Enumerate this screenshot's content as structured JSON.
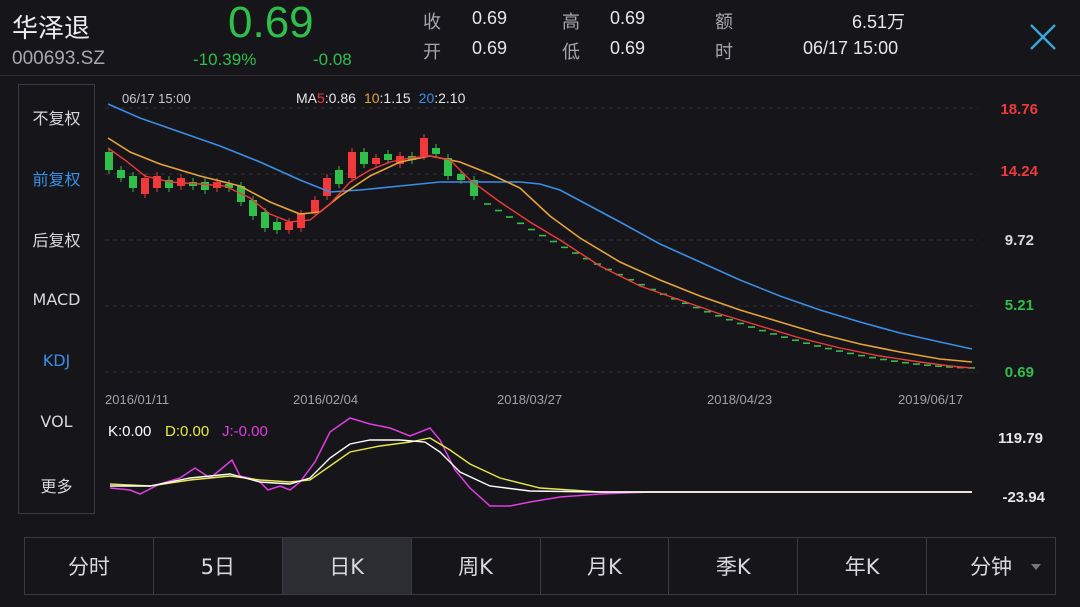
{
  "header": {
    "name": "华泽退",
    "code": "000693.SZ",
    "price": "0.69",
    "change_pct": "-10.39%",
    "change_abs": "-0.08",
    "quotes": [
      {
        "label": "收",
        "value": "0.69"
      },
      {
        "label": "高",
        "value": "0.69"
      },
      {
        "label": "额",
        "value": "6.51万"
      },
      {
        "label": "开",
        "value": "0.69"
      },
      {
        "label": "低",
        "value": "0.69"
      },
      {
        "label": "时",
        "value": "06/17 15:00"
      }
    ]
  },
  "sidebar": {
    "items": [
      {
        "label": "不复权",
        "active": false
      },
      {
        "label": "前复权",
        "active": true
      },
      {
        "label": "后复权",
        "active": false
      },
      {
        "label": "MACD",
        "active": false
      },
      {
        "label": "KDJ",
        "active": true
      },
      {
        "label": "VOL",
        "active": false
      },
      {
        "label": "更多",
        "active": false
      }
    ]
  },
  "kline": {
    "crosshair_date": "06/17 15:00",
    "ma": {
      "ma5_prefix": "MA",
      "ma5_num": "5",
      "ma5_val": ":0.86",
      "ma10_num": "10",
      "ma10_val": ":1.15",
      "ma20_num": "20",
      "ma20_val": ":2.10"
    },
    "y_ticks": [
      "18.76",
      "14.24",
      "9.72",
      "5.21",
      "0.69"
    ],
    "x_ticks": [
      "2016/01/11",
      "2016/02/04",
      "2018/03/27",
      "2018/04/23",
      "2019/06/17"
    ]
  },
  "kdj": {
    "k": "K:0.00",
    "d": "D:0.00",
    "j": "J:-0.00",
    "y_ticks": [
      "119.79",
      "-23.94"
    ]
  },
  "tabs": [
    {
      "label": "分时",
      "active": false
    },
    {
      "label": "5日",
      "active": false
    },
    {
      "label": "日K",
      "active": true
    },
    {
      "label": "周K",
      "active": false
    },
    {
      "label": "月K",
      "active": false
    },
    {
      "label": "季K",
      "active": false
    },
    {
      "label": "年K",
      "active": false
    },
    {
      "label": "分钟",
      "active": false
    }
  ],
  "colors": {
    "up": "#f0393a",
    "down": "#2fbf4a",
    "ma5": "#f0393a",
    "ma10": "#e6a33a",
    "ma20": "#3a8ee6",
    "k": "#ffffff",
    "d": "#e8e84a",
    "j": "#e03ee0",
    "accent": "#3a8ee6"
  },
  "chart_data": {
    "type": "candlestick",
    "series": [
      {
        "name": "MA5",
        "values": [
          0.86
        ]
      },
      {
        "name": "10",
        "values": [
          1.15
        ]
      },
      {
        "name": "20",
        "values": [
          2.1
        ]
      },
      {
        "name": "K",
        "values": [
          0.0
        ]
      },
      {
        "name": "D",
        "values": [
          0.0
        ]
      },
      {
        "name": "J",
        "values": [
          -0.0
        ]
      }
    ],
    "x": [
      "2016/01/11",
      "2016/02/04",
      "2018/03/27",
      "2018/04/23",
      "2019/06/17"
    ],
    "ylim": [
      0.69,
      18.76
    ],
    "kdj_ylim": [
      -23.94,
      119.79
    ],
    "last_close": 0.69
  }
}
